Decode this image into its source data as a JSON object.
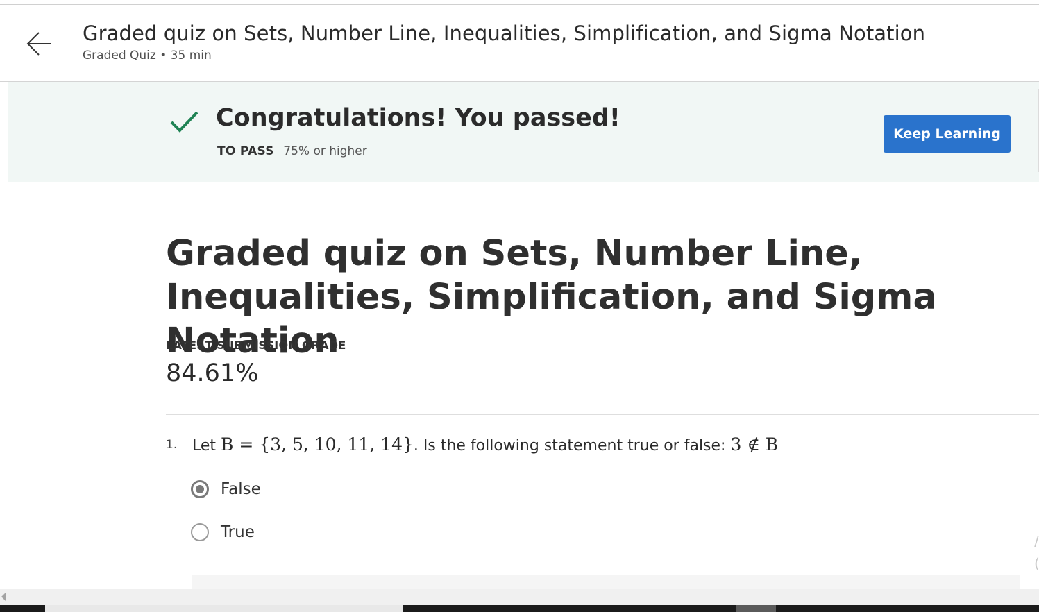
{
  "header": {
    "back_icon": "arrow-left-icon",
    "title": "Graded quiz on Sets, Number Line, Inequalities, Simplification, and Sigma Notation",
    "subtitle": "Graded Quiz • 35 min"
  },
  "banner": {
    "icon": "checkmark-icon",
    "heading": "Congratulations! You passed!",
    "pass_label": "TO PASS",
    "pass_value": "75% or higher",
    "keep_learning_label": "Keep Learning",
    "colors": {
      "check": "#1f8354",
      "button": "#2a73cc",
      "background": "#f1f7f5"
    }
  },
  "main": {
    "title": "Graded quiz on Sets, Number Line, Inequalities, Simplification, and Sigma Notation",
    "grade_label": "LATEST SUBMISSION GRADE",
    "grade_value": "84.61%"
  },
  "question1": {
    "number": "1.",
    "text_prefix": "Let",
    "math_set": "B = {3, 5, 10, 11, 14}",
    "text_middle": ". Is the following statement true or false:",
    "math_statement": "3 ∉ B",
    "options": [
      {
        "label": "False",
        "selected": true
      },
      {
        "label": "True",
        "selected": false
      }
    ]
  }
}
